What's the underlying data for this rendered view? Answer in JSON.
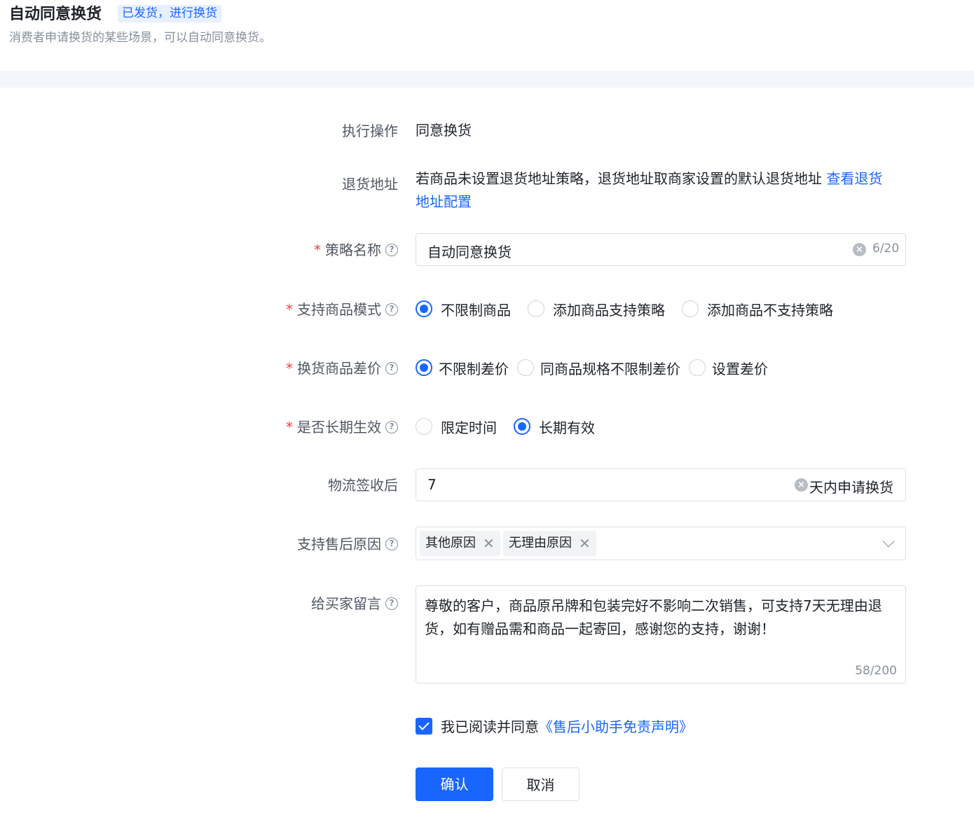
{
  "header": {
    "title": "自动同意换货",
    "tag": "已发货，进行换货",
    "description": "消费者申请换货的某些场景，可以自动同意换货。"
  },
  "form": {
    "action": {
      "label": "执行操作",
      "value": "同意换货"
    },
    "return_address": {
      "label": "退货地址",
      "text": "若商品未设置退货地址策略，退货地址取商家设置的默认退货地址",
      "link_line1": "查看退货",
      "link_line2": "地址配置"
    },
    "policy_name": {
      "label": "策略名称",
      "value": "自动同意换货",
      "counter": "6/20"
    },
    "product_mode": {
      "label": "支持商品模式",
      "options": [
        "不限制商品",
        "添加商品支持策略",
        "添加商品不支持策略"
      ],
      "selected": 0
    },
    "price_diff": {
      "label": "换货商品差价",
      "options": [
        "不限制差价",
        "同商品规格不限制差价",
        "设置差价"
      ],
      "selected": 0
    },
    "long_term": {
      "label": "是否长期生效",
      "options": [
        "限定时间",
        "长期有效"
      ],
      "selected": 1
    },
    "logistics": {
      "label": "物流签收后",
      "value": "7",
      "suffix": "天内申请换货"
    },
    "reasons": {
      "label": "支持售后原因",
      "tags": [
        "其他原因",
        "无理由原因"
      ]
    },
    "message": {
      "label": "给买家留言",
      "value": "尊敬的客户，商品原吊牌和包装完好不影响二次销售，可支持7天无理由退货，如有赠品需和商品一起寄回，感谢您的支持，谢谢！",
      "counter": "58/200"
    },
    "agreement": {
      "checked": true,
      "text": "我已阅读并同意",
      "link": "《售后小助手免责声明》"
    },
    "confirm_label": "确认",
    "cancel_label": "取消"
  },
  "colors": {
    "primary": "#1966ff",
    "required": "#f53f3f",
    "band": "#f4f6fb"
  },
  "icons": [
    "help-icon",
    "clear-icon",
    "close-icon",
    "chevron-down-icon",
    "check-icon"
  ]
}
